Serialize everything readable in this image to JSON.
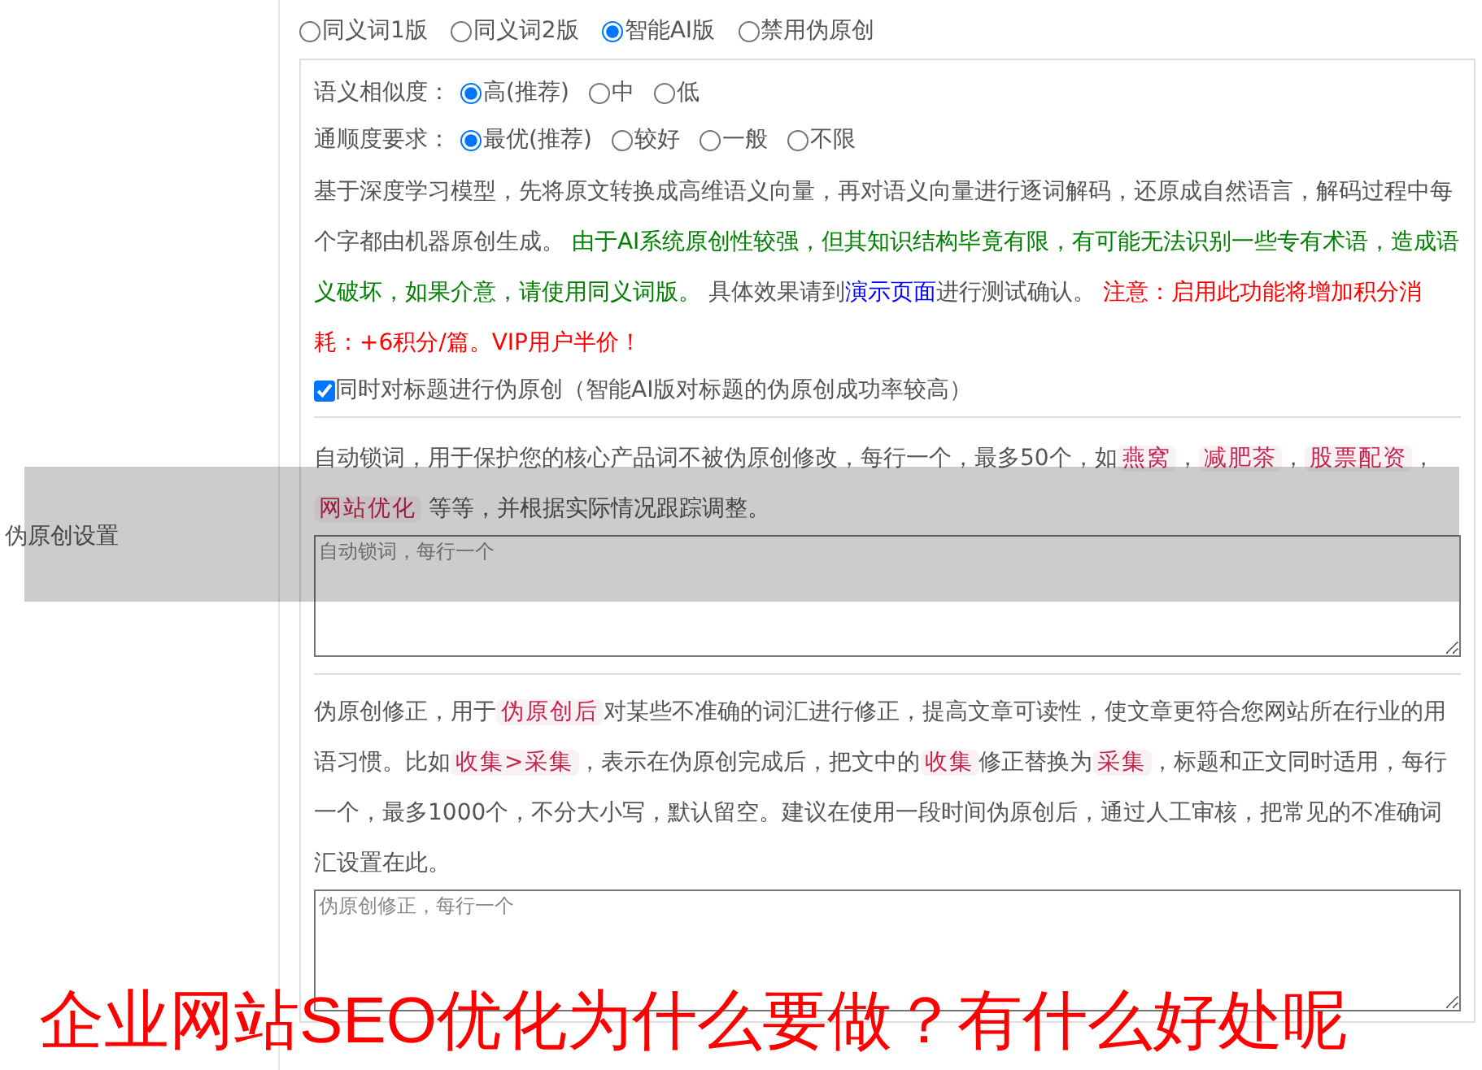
{
  "mode_options": [
    {
      "label": "同义词1版",
      "selected": false
    },
    {
      "label": "同义词2版",
      "selected": false
    },
    {
      "label": "智能AI版",
      "selected": true
    },
    {
      "label": "禁用伪原创",
      "selected": false
    }
  ],
  "similarity": {
    "label": "语义相似度：",
    "options": [
      {
        "label": "高(推荐)",
        "selected": true
      },
      {
        "label": "中",
        "selected": false
      },
      {
        "label": "低",
        "selected": false
      }
    ]
  },
  "fluency": {
    "label": "通顺度要求：",
    "options": [
      {
        "label": "最优(推荐)",
        "selected": true
      },
      {
        "label": "较好",
        "selected": false
      },
      {
        "label": "一般",
        "selected": false
      },
      {
        "label": "不限",
        "selected": false
      }
    ]
  },
  "ai_description": [
    {
      "kind": "plain",
      "text": "基于深度学习模型，先将原文转换成高维语义向量，再对语义向量进行逐词解码，还原成自然语言，解码过程中每个字都由机器原创生成。 "
    },
    {
      "kind": "notice",
      "text": "由于AI系统原创性较强，但其知识结构毕竟有限，有可能无法识别一些专有术语，造成语义破坏，如果介意，请使用同义词版。"
    },
    {
      "kind": "plain",
      "text": " 具体效果请到"
    },
    {
      "kind": "link",
      "text": "演示页面"
    },
    {
      "kind": "plain",
      "text": "进行测试确认。 "
    },
    {
      "kind": "warning",
      "text": "注意：启用此功能将增加积分消耗：+6积分/篇。VIP用户半价！"
    }
  ],
  "title_checkbox": {
    "label": "同时对标题进行伪原创（智能AI版对标题的伪原创成功率较高）",
    "checked": true
  },
  "section_label": "伪原创设置",
  "lock_words": {
    "description": [
      {
        "kind": "plain",
        "text": "自动锁词，用于保护您的核心产品词不被伪原创修改，每行一个，最多50个，如"
      },
      {
        "kind": "code",
        "text": "燕窝"
      },
      {
        "kind": "plain",
        "text": "，"
      },
      {
        "kind": "code",
        "text": "减肥茶"
      },
      {
        "kind": "plain",
        "text": "，"
      },
      {
        "kind": "code",
        "text": "股票配资"
      },
      {
        "kind": "plain",
        "text": "，"
      },
      {
        "kind": "code",
        "text": "网站优化"
      },
      {
        "kind": "plain",
        "text": " 等等，并根据实际情况跟踪调整。"
      }
    ],
    "placeholder": "自动锁词，每行一个"
  },
  "correction": {
    "description": [
      {
        "kind": "plain",
        "text": "伪原创修正，用于"
      },
      {
        "kind": "code",
        "text": "伪原创后"
      },
      {
        "kind": "plain",
        "text": "对某些不准确的词汇进行修正，提高文章可读性，使文章更符合您网站所在行业的用语习惯。比如"
      },
      {
        "kind": "code",
        "text": "收集>采集"
      },
      {
        "kind": "plain",
        "text": "，表示在伪原创完成后，把文中的"
      },
      {
        "kind": "code",
        "text": "收集"
      },
      {
        "kind": "plain",
        "text": "修正替换为"
      },
      {
        "kind": "code",
        "text": "采集"
      },
      {
        "kind": "plain",
        "text": "，标题和正文同时适用，每行一个，最多1000个，不分大小写，默认留空。建议在使用一段时间伪原创后，通过人工审核，把常见的不准确词汇设置在此。"
      }
    ],
    "placeholder": "伪原创修正，每行一个"
  },
  "caption": "企业网站SEO优化为什么要做？有什么好处呢"
}
